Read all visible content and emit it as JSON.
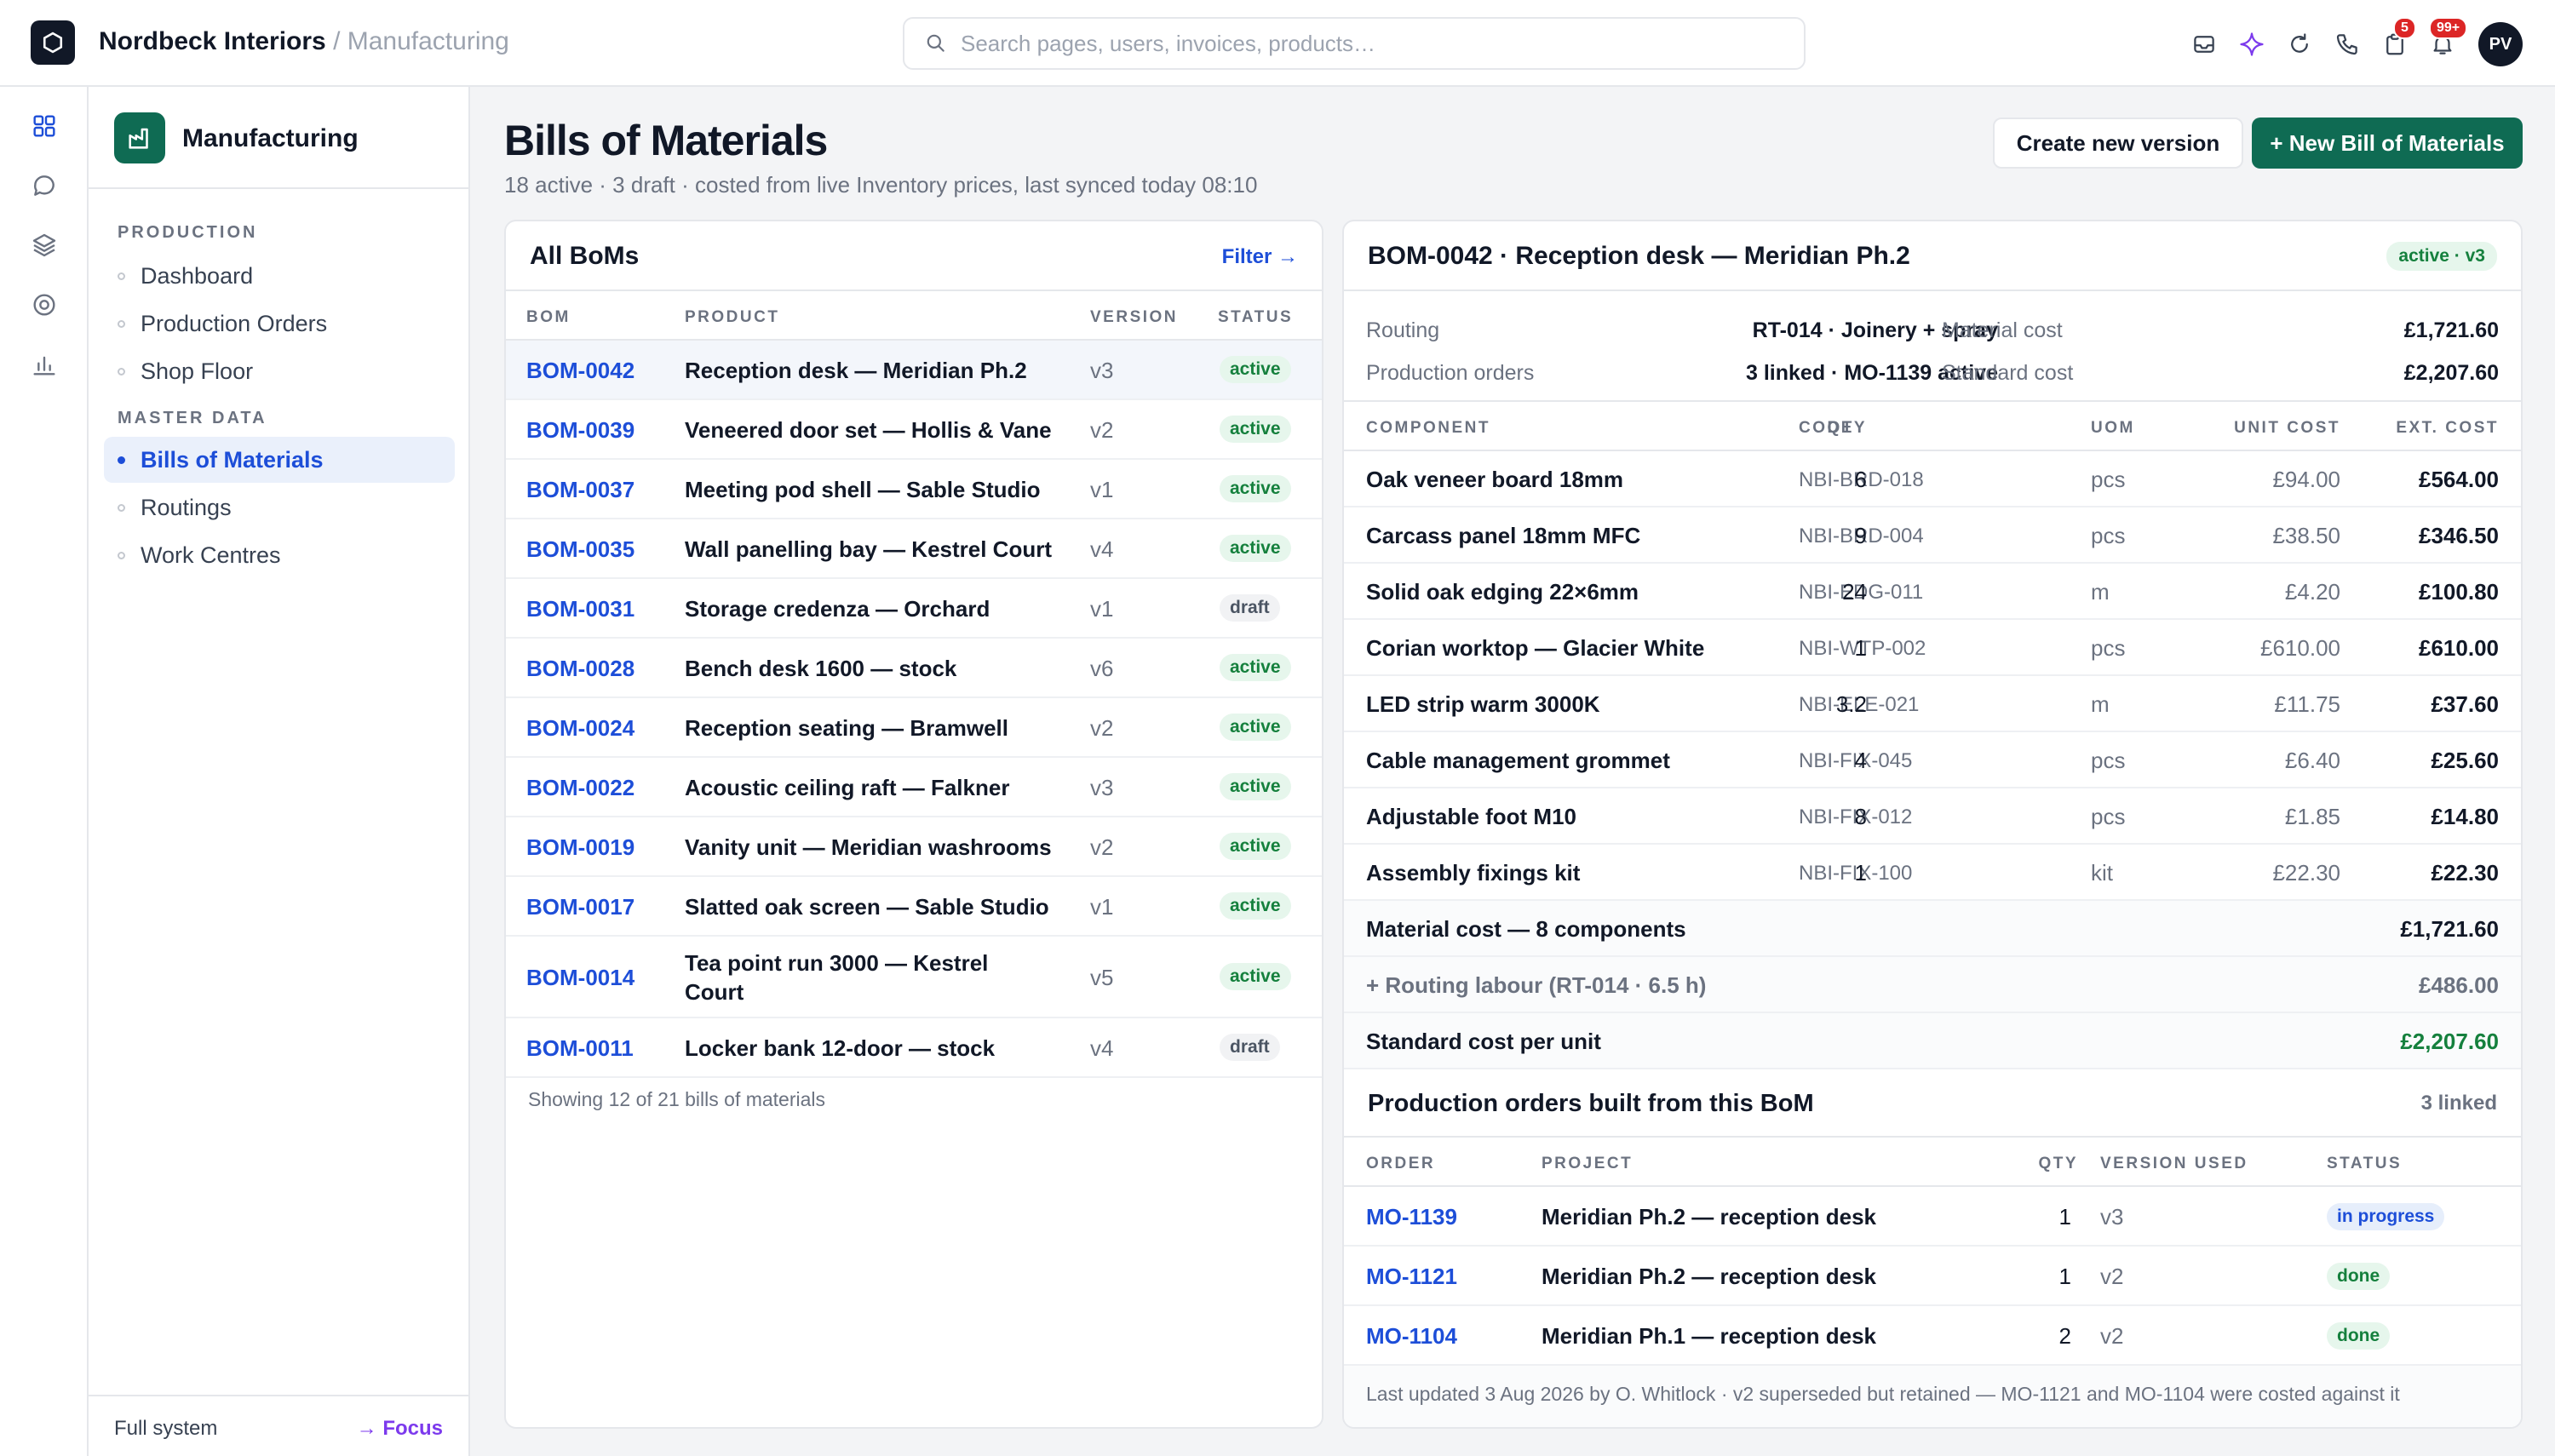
{
  "header": {
    "brand": "Nordbeck Interiors",
    "crumb": " / Manufacturing",
    "search_placeholder": "Search pages, users, invoices, products…",
    "badges": {
      "tasks": "5",
      "notifications": "99+"
    },
    "avatar": "PV"
  },
  "sidebar": {
    "module_title": "Manufacturing",
    "sections": [
      {
        "label": "PRODUCTION",
        "items": [
          "Dashboard",
          "Production Orders",
          "Shop Floor"
        ]
      },
      {
        "label": "MASTER DATA",
        "items": [
          "Bills of Materials",
          "Routings",
          "Work Centres"
        ]
      }
    ],
    "active_item": "Bills of Materials",
    "footer_left": "Full system",
    "footer_right": "→ Focus"
  },
  "page": {
    "title": "Bills of Materials",
    "subtitle": "18 active · 3 draft · costed from live Inventory prices, last synced today 08:10",
    "btn_create_version": "Create new version",
    "btn_new_bom": "+ New Bill of Materials"
  },
  "bom_list": {
    "title": "All BoMs",
    "filter": "Filter →",
    "columns": [
      "BOM",
      "PRODUCT",
      "VERSION",
      "STATUS"
    ],
    "rows": [
      {
        "id": "BOM-0042",
        "product": "Reception desk — Meridian Ph.2",
        "version": "v3",
        "status": "active"
      },
      {
        "id": "BOM-0039",
        "product": "Veneered door set — Hollis & Vane",
        "version": "v2",
        "status": "active"
      },
      {
        "id": "BOM-0037",
        "product": "Meeting pod shell — Sable Studio",
        "version": "v1",
        "status": "active"
      },
      {
        "id": "BOM-0035",
        "product": "Wall panelling bay — Kestrel Court",
        "version": "v4",
        "status": "active"
      },
      {
        "id": "BOM-0031",
        "product": "Storage credenza — Orchard",
        "version": "v1",
        "status": "draft"
      },
      {
        "id": "BOM-0028",
        "product": "Bench desk 1600 — stock",
        "version": "v6",
        "status": "active"
      },
      {
        "id": "BOM-0024",
        "product": "Reception seating — Bramwell",
        "version": "v2",
        "status": "active"
      },
      {
        "id": "BOM-0022",
        "product": "Acoustic ceiling raft — Falkner",
        "version": "v3",
        "status": "active"
      },
      {
        "id": "BOM-0019",
        "product": "Vanity unit — Meridian washrooms",
        "version": "v2",
        "status": "active"
      },
      {
        "id": "BOM-0017",
        "product": "Slatted oak screen — Sable Studio",
        "version": "v1",
        "status": "active"
      },
      {
        "id": "BOM-0014",
        "product_line1": "Tea point run 3000 — Kestrel",
        "product_line2": "Court",
        "version": "v5",
        "status": "active"
      },
      {
        "id": "BOM-0011",
        "product": "Locker bank 12-door — stock",
        "version": "v4",
        "status": "draft"
      }
    ],
    "footer": "Showing 12 of 21 bills of materials"
  },
  "detail": {
    "title": "BOM-0042 · Reception desk — Meridian Ph.2",
    "status": "active · v3",
    "routing_label": "Routing",
    "routing_value": "RT-014 · Joinery + spray",
    "orders_label": "Production orders",
    "orders_value": "3 linked · MO-1139 active",
    "material_cost_label": "Material cost",
    "material_cost_value": "£1,721.60",
    "standard_cost_label": "Standard cost",
    "standard_cost_value": "£2,207.60",
    "columns": [
      "COMPONENT",
      "CODE",
      "QTY",
      "UOM",
      "UNIT COST",
      "EXT. COST"
    ],
    "components": [
      {
        "name": "Oak veneer board 18mm",
        "code": "NBI-BRD-018",
        "qty": "6",
        "uom": "pcs",
        "unit": "£94.00",
        "ext": "£564.00"
      },
      {
        "name": "Carcass panel 18mm MFC",
        "code": "NBI-BRD-004",
        "qty": "9",
        "uom": "pcs",
        "unit": "£38.50",
        "ext": "£346.50"
      },
      {
        "name": "Solid oak edging 22×6mm",
        "code": "NBI-EDG-011",
        "qty": "24",
        "uom": "m",
        "unit": "£4.20",
        "ext": "£100.80"
      },
      {
        "name": "Corian worktop — Glacier White",
        "code": "NBI-WTP-002",
        "qty": "1",
        "uom": "pcs",
        "unit": "£610.00",
        "ext": "£610.00"
      },
      {
        "name": "LED strip warm 3000K",
        "code": "NBI-ELE-021",
        "qty": "3.2",
        "uom": "m",
        "unit": "£11.75",
        "ext": "£37.60"
      },
      {
        "name": "Cable management grommet",
        "code": "NBI-FIX-045",
        "qty": "4",
        "uom": "pcs",
        "unit": "£6.40",
        "ext": "£25.60"
      },
      {
        "name": "Adjustable foot M10",
        "code": "NBI-FIX-012",
        "qty": "8",
        "uom": "pcs",
        "unit": "£1.85",
        "ext": "£14.80"
      },
      {
        "name": "Assembly fixings kit",
        "code": "NBI-FIX-100",
        "qty": "1",
        "uom": "kit",
        "unit": "£22.30",
        "ext": "£22.30"
      }
    ],
    "sum_material_label": "Material cost — 8 components",
    "sum_material_value": "£1,721.60",
    "sum_labour_label": "+ Routing labour (RT-014 · 6.5 h)",
    "sum_labour_value": "£486.00",
    "sum_standard_label": "Standard cost per unit",
    "sum_standard_value": "£2,207.60",
    "orders_title": "Production orders built from this BoM",
    "orders_count": "3 linked",
    "order_columns": [
      "ORDER",
      "PROJECT",
      "QTY",
      "VERSION USED",
      "STATUS"
    ],
    "orders": [
      {
        "id": "MO-1139",
        "project": "Meridian Ph.2 — reception desk",
        "qty": "1",
        "version": "v3",
        "status": "in progress"
      },
      {
        "id": "MO-1121",
        "project": "Meridian Ph.2 — reception desk",
        "qty": "1",
        "version": "v2",
        "status": "done"
      },
      {
        "id": "MO-1104",
        "project": "Meridian Ph.1 — reception desk",
        "qty": "2",
        "version": "v2",
        "status": "done"
      }
    ],
    "footer": "Last updated 3 Aug 2026 by O. Whitlock · v2 superseded but retained — MO-1121 and MO-1104 were costed against it"
  },
  "colors": {
    "accent": "#0f6b53",
    "link": "#1d4ed8",
    "active_green": "#15803d",
    "focus": "#7c3aed"
  },
  "icons": [
    "app-logo-icon",
    "search-icon",
    "inbox-icon",
    "sparkle-icon",
    "refresh-icon",
    "phone-icon",
    "clipboard-icon",
    "bell-icon",
    "grid-icon",
    "chat-icon",
    "layers-icon",
    "target-icon",
    "bar-chart-icon",
    "factory-icon"
  ]
}
